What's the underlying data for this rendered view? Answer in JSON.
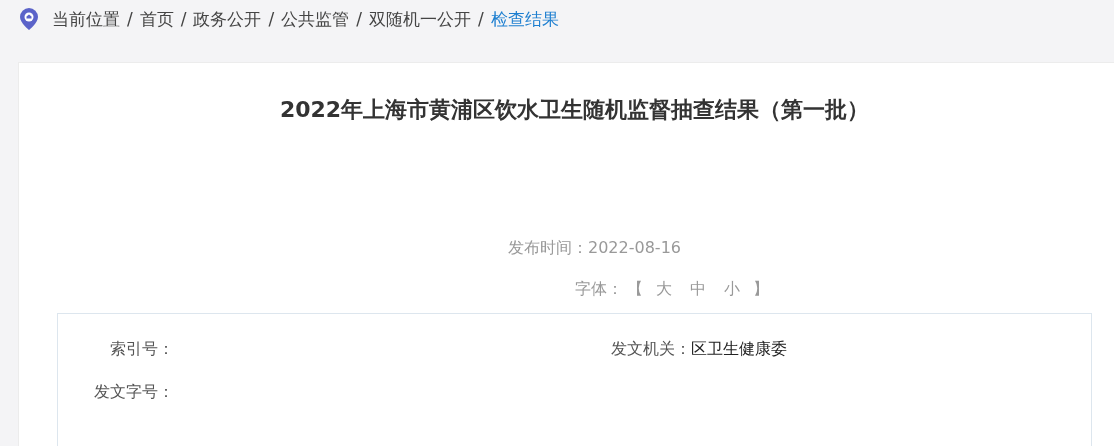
{
  "breadcrumb": {
    "location_label": "当前位置",
    "crumbs": [
      {
        "separator": "/",
        "label": "首页",
        "selected": false
      },
      {
        "separator": "/",
        "label": "政务公开",
        "selected": false
      },
      {
        "separator": "/",
        "label": "公共监管",
        "selected": false
      },
      {
        "separator": "/",
        "label": "双随机一公开",
        "selected": false
      },
      {
        "separator": "/",
        "label": "检查结果",
        "selected": true
      }
    ]
  },
  "article": {
    "title": "2022年上海市黄浦区饮水卫生随机监督抽查结果（第一批）",
    "publish_label": "发布时间：",
    "publish_date": "2022-08-16",
    "font_size": {
      "label": "字体：",
      "open": "【",
      "options": [
        "大",
        "中",
        "小"
      ],
      "close": "】"
    },
    "info": [
      {
        "label": "索引号："
      },
      {
        "label": "发文机关：",
        "value": "区卫生健康委"
      },
      {
        "label": "发文字号："
      }
    ]
  }
}
